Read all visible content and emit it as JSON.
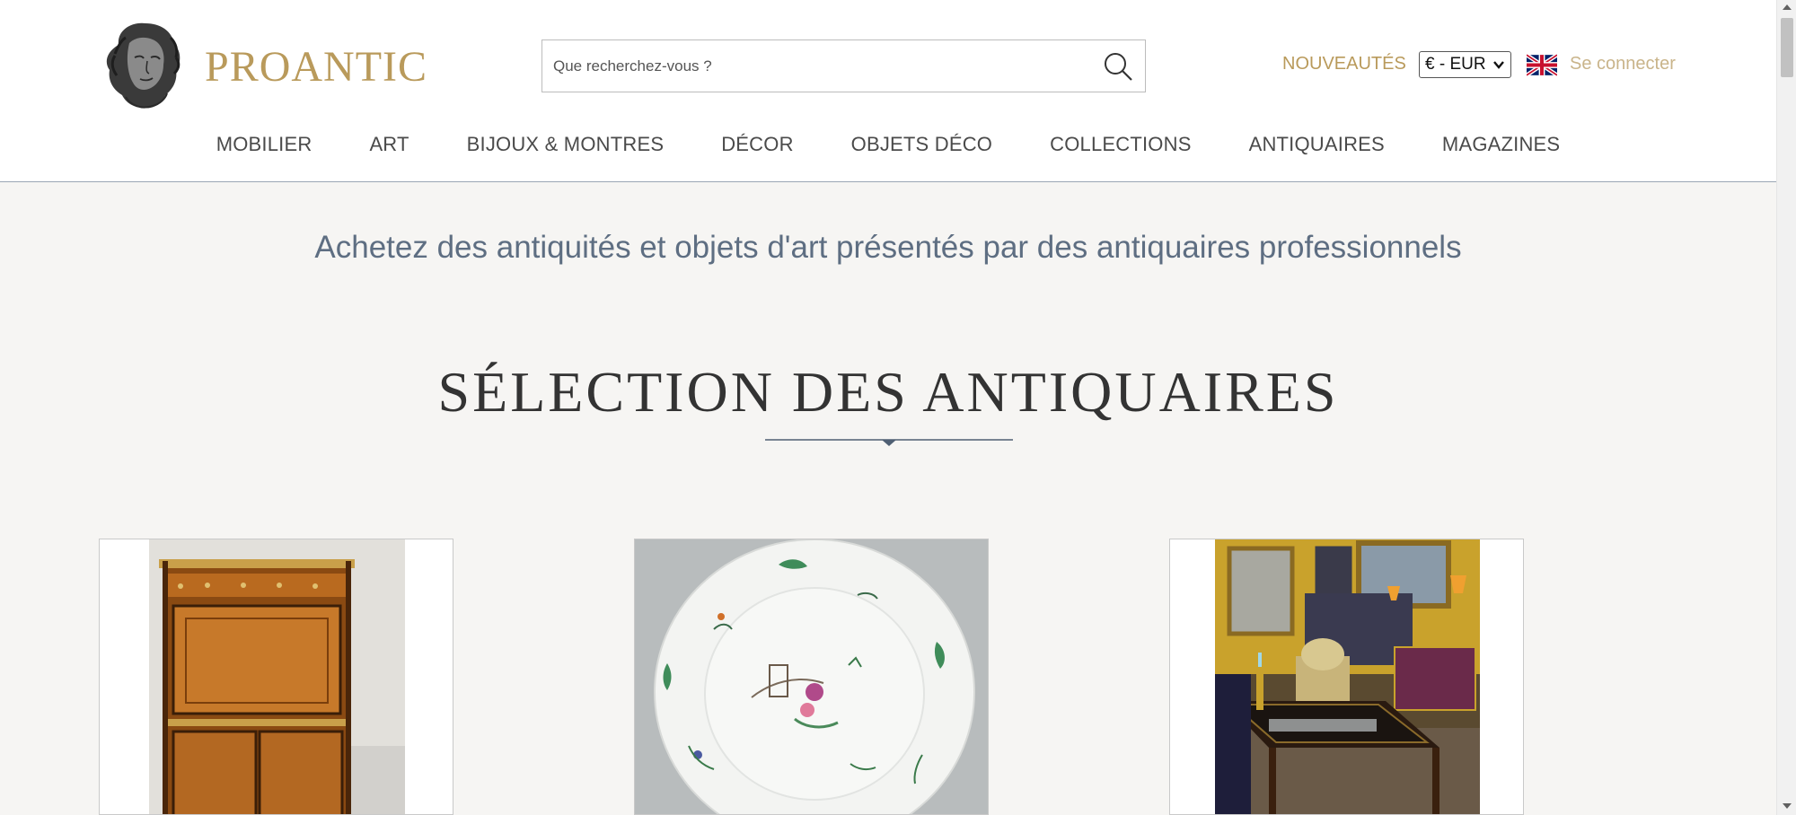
{
  "header": {
    "logo_text": "PROANTIC",
    "search_placeholder": "Que recherchez-vous ?",
    "nouveautes_label": "NOUVEAUTÉS",
    "currency_value": "€ - EUR",
    "login_label": "Se connecter",
    "icons": {
      "logo": "classical-head-bust-icon",
      "search": "search-icon",
      "language": "uk-flag-icon"
    }
  },
  "nav": {
    "items": [
      {
        "label": "MOBILIER"
      },
      {
        "label": "ART"
      },
      {
        "label": "BIJOUX & MONTRES"
      },
      {
        "label": "DÉCOR"
      },
      {
        "label": "OBJETS DÉCO"
      },
      {
        "label": "COLLECTIONS"
      },
      {
        "label": "ANTIQUAIRES"
      },
      {
        "label": "MAGAZINES"
      }
    ]
  },
  "main": {
    "tagline": "Achetez des antiquités et objets d'art présentés par des antiquaires professionnels",
    "section_title": "SÉLECTION DES ANTIQUAIRES",
    "cards": [
      {
        "image": "secretary-desk-photo"
      },
      {
        "image": "porcelain-plate-photo"
      },
      {
        "image": "games-table-showroom-photo"
      }
    ]
  },
  "colors": {
    "brand_gold": "#b99a5b",
    "login_gold": "#c9b48a",
    "tagline_blue": "#5e6e82",
    "page_bg": "#f6f5f3",
    "divider": "#4f5f73"
  }
}
